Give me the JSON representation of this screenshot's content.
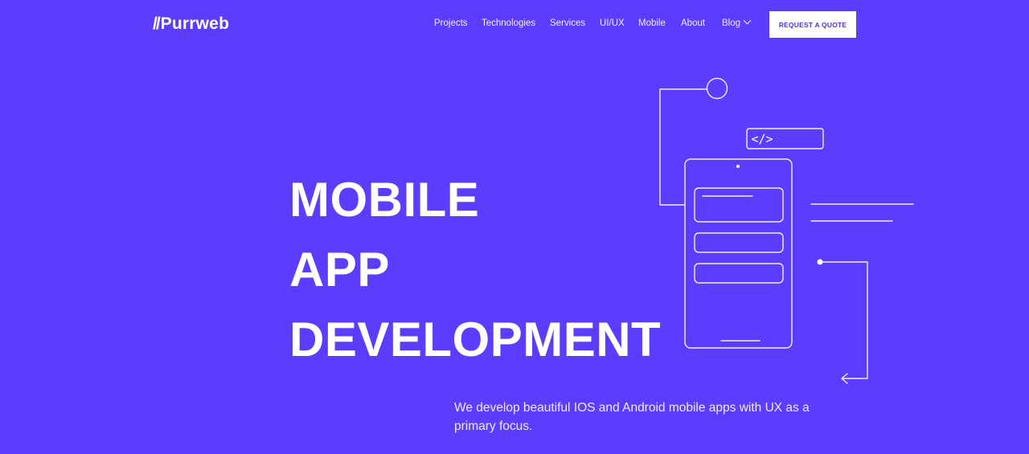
{
  "brand": {
    "logo_mark": "//",
    "logo_text": "Purrweb"
  },
  "nav": {
    "items": [
      {
        "label": "Projects"
      },
      {
        "label": "Technologies"
      },
      {
        "label": "Services"
      },
      {
        "label": "UI/UX"
      },
      {
        "label": "Mobile"
      },
      {
        "label": "About"
      },
      {
        "label": "Blog"
      }
    ],
    "cta_label": "REQUEST A QUOTE"
  },
  "hero": {
    "title_lines": [
      "MOBILE",
      "APP",
      "DEVELOPMENT"
    ],
    "subtitle": "We develop beautiful IOS and Android mobile apps with UX as a primary focus."
  },
  "illustration": {
    "code_tag": "</>"
  },
  "colors": {
    "background": "#5a3dff",
    "foreground": "#ffffff",
    "button_text": "#4b35d8"
  }
}
